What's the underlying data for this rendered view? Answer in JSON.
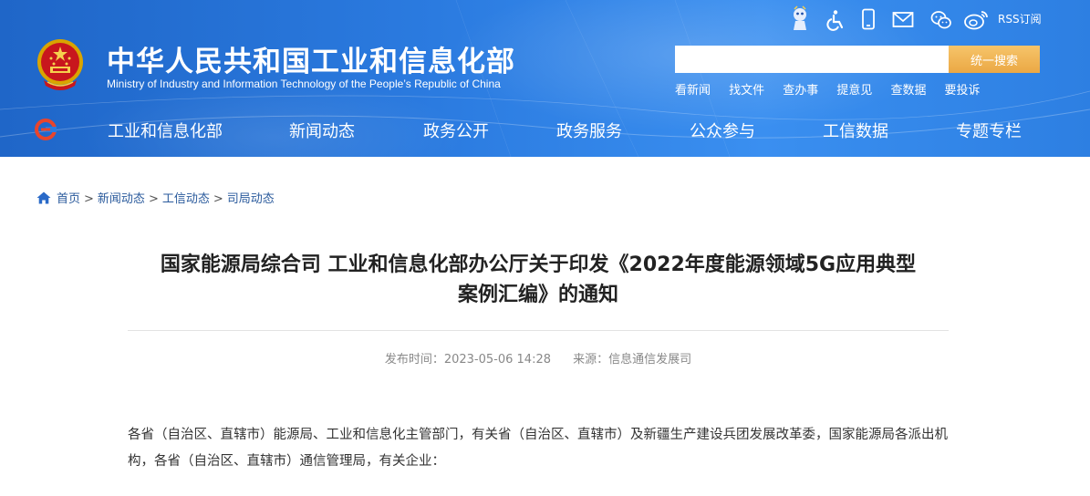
{
  "header": {
    "title": "中华人民共和国工业和信息化部",
    "subtitle": "Ministry of Industry and Information Technology of the People’s Republic of China",
    "top_icons": [
      "mascot-icon",
      "accessibility-icon",
      "mobile-icon",
      "mail-icon",
      "wechat-icon",
      "weibo-icon"
    ],
    "rss_label": "RSS订阅",
    "search": {
      "placeholder": "",
      "button_label": "统一搜索"
    },
    "quick_links": [
      "看新闻",
      "找文件",
      "查办事",
      "提意见",
      "查数据",
      "要投诉"
    ]
  },
  "nav": {
    "items": [
      "工业和信息化部",
      "新闻动态",
      "政务公开",
      "政务服务",
      "公众参与",
      "工信数据",
      "专题专栏"
    ]
  },
  "breadcrumb": {
    "items": [
      "首页",
      "新闻动态",
      "工信动态",
      "司局动态"
    ],
    "separator": ">"
  },
  "article": {
    "title_line1": "国家能源局综合司 工业和信息化部办公厅关于印发《2022年度能源领域5G应用典型",
    "title_line2": "案例汇编》的通知",
    "publish_time": "发布时间：2023-05-06 14:28",
    "source": "来源：信息通信发展司",
    "body": "各省（自治区、直辖市）能源局、工业和信息化主管部门，有关省（自治区、直辖市）及新疆生产建设兵团发展改革委，国家能源局各派出机构，各省（自治区、直辖市）通信管理局，有关企业："
  },
  "colors": {
    "header_blue": "#2b7be0",
    "search_button": "#eba844",
    "breadcrumb_link": "#2a5a9c",
    "meta_gray": "#888888"
  }
}
